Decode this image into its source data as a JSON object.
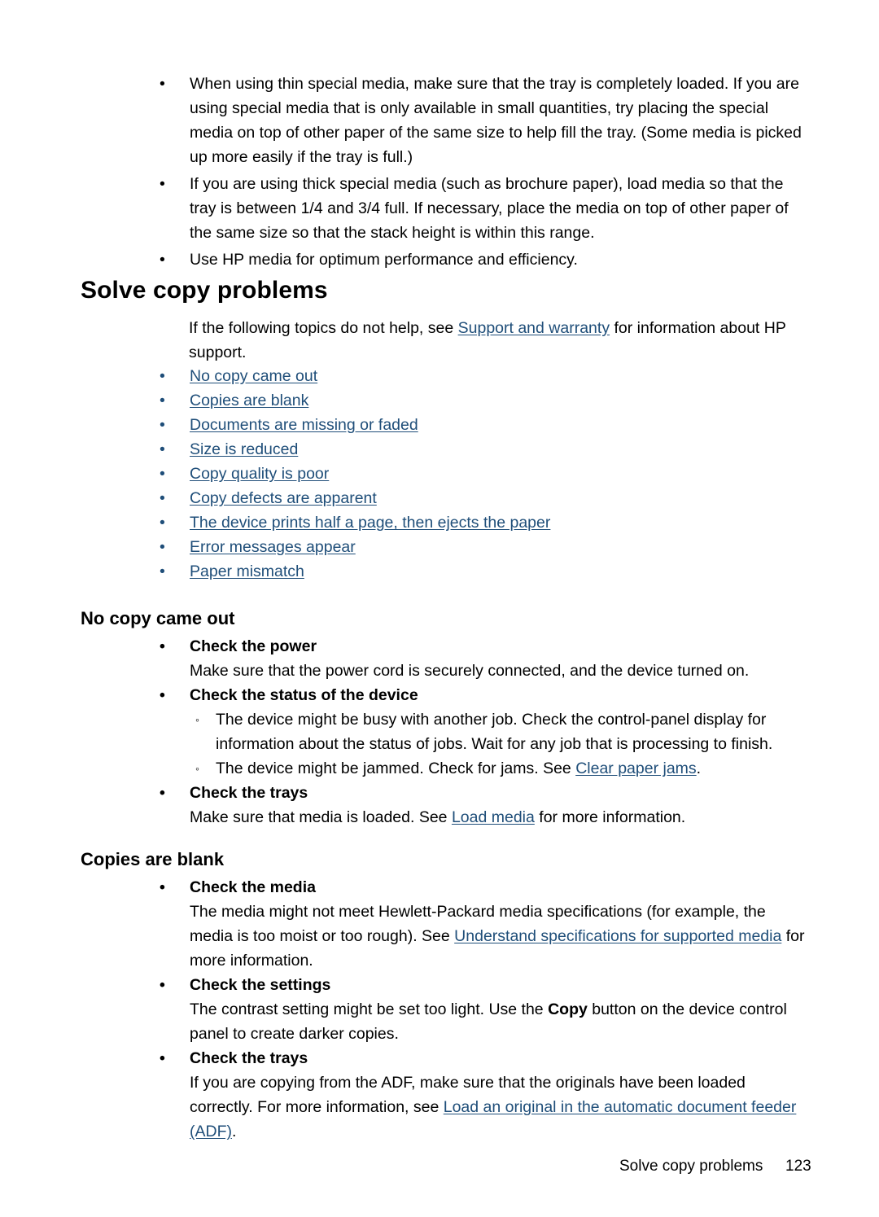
{
  "page": {
    "link_color": "#1f4e79",
    "text_color": "#000000",
    "background": "#ffffff"
  },
  "top_tips": {
    "bullet_marker": "•",
    "items": [
      "When using thin special media, make sure that the tray is completely loaded. If you are using special media that is only available in small quantities, try placing the special media on top of other paper of the same size to help fill the tray. (Some media is picked up more easily if the tray is full.)",
      "If you are using thick special media (such as brochure paper), load media so that the tray is between 1/4 and 3/4 full. If necessary, place the media on top of other paper of the same size so that the stack height is within this range.",
      "Use HP media for optimum performance and efficiency."
    ]
  },
  "heading": {
    "title": "Solve copy problems"
  },
  "intro": {
    "before_link": "If the following topics do not help, see ",
    "link": "Support and warranty",
    "after_link": " for information about HP support."
  },
  "toc": {
    "bullet_marker": "•",
    "links": [
      "No copy came out",
      "Copies are blank",
      "Documents are missing or faded",
      "Size is reduced",
      "Copy quality is poor",
      "Copy defects are apparent",
      "The device prints half a page, then ejects the paper",
      "Error messages appear",
      "Paper mismatch"
    ]
  },
  "section_no_copy": {
    "heading": "No copy came out",
    "bullet_marker": "•",
    "circle_marker": "◦",
    "check_power": {
      "title": "Check the power",
      "body": "Make sure that the power cord is securely connected, and the device turned on."
    },
    "check_status": {
      "title": "Check the status of the device",
      "sub_items": [
        {
          "text": "The device might be busy with another job. Check the control-panel display for information about the status of jobs. Wait for any job that is processing to finish.",
          "link": "",
          "after": ""
        },
        {
          "text": "The device might be jammed. Check for jams. See ",
          "link": "Clear paper jams",
          "after": "."
        }
      ]
    },
    "check_trays": {
      "title": "Check the trays",
      "before_link": "Make sure that media is loaded. See ",
      "link": "Load media",
      "after_link": " for more information."
    }
  },
  "section_copies_blank": {
    "heading": "Copies are blank",
    "bullet_marker": "•",
    "check_media": {
      "title": "Check the media",
      "before_link": "The media might not meet Hewlett-Packard media specifications (for example, the media is too moist or too rough). See ",
      "link": "Understand specifications for supported media",
      "after_link": " for more information."
    },
    "check_settings": {
      "title": "Check the settings",
      "before_bold": "The contrast setting might be set too light. Use the ",
      "bold_word": "Copy",
      "after_bold": " button on the device control panel to create darker copies."
    },
    "check_trays": {
      "title": "Check the trays",
      "before_link": "If you are copying from the ADF, make sure that the originals have been loaded correctly. For more information, see ",
      "link": "Load an original in the automatic document feeder (ADF)",
      "after_link": "."
    }
  },
  "footer": {
    "title": "Solve copy problems",
    "page_number": "123"
  }
}
